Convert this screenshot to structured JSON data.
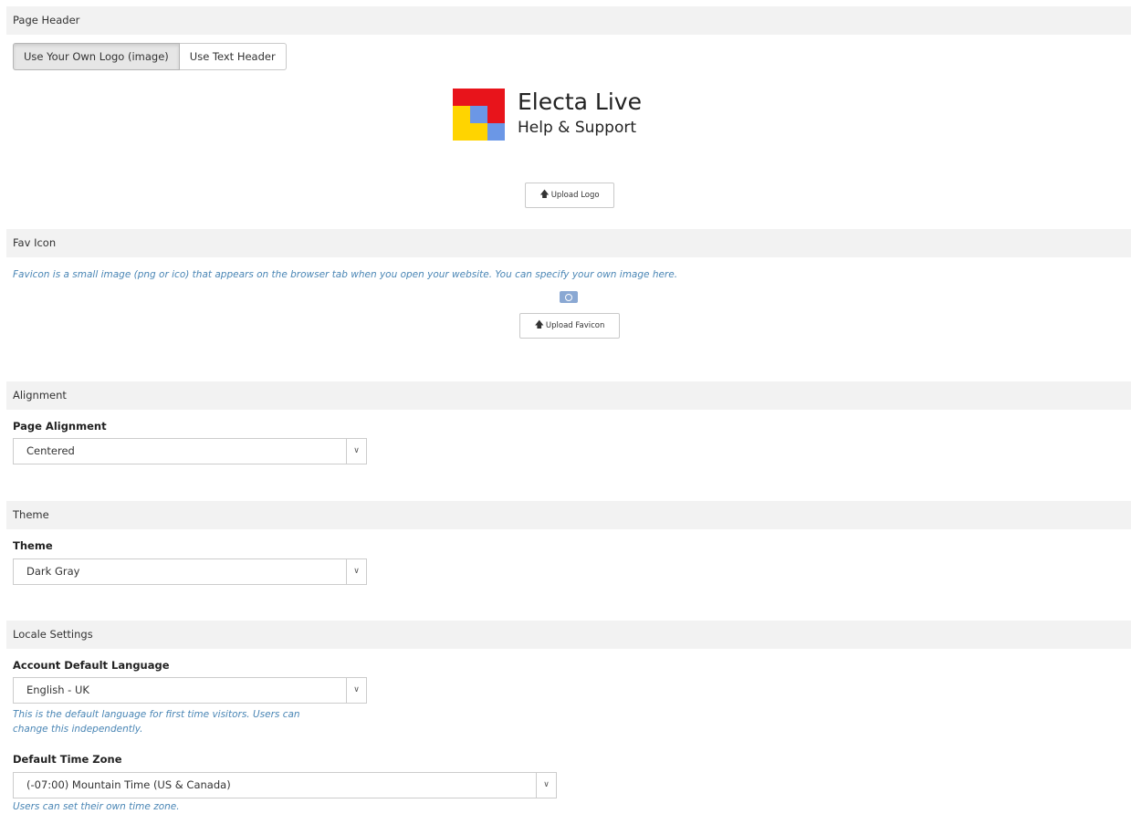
{
  "sections": {
    "page_header": "Page Header",
    "fav_icon": "Fav Icon",
    "alignment": "Alignment",
    "theme": "Theme",
    "locale": "Locale Settings"
  },
  "header_toggle": {
    "logo_option": "Use Your Own Logo (image)",
    "text_option": "Use Text Header",
    "selected": "logo_option"
  },
  "logo": {
    "line1": "Electa Live",
    "line2": "Help & Support",
    "colors": {
      "red": "#e8141b",
      "yellow": "#ffd400",
      "blue": "#6b97e6"
    }
  },
  "upload_logo_label": "Upload Logo",
  "favicon": {
    "help": "Favicon is a small image (png or ico) that appears on the browser tab when you open your website. You can specify your own image here.",
    "upload_label": "Upload Favicon"
  },
  "alignment": {
    "label": "Page Alignment",
    "value": "Centered"
  },
  "theme": {
    "label": "Theme",
    "value": "Dark Gray"
  },
  "locale": {
    "language_label": "Account Default Language",
    "language_value": "English - UK",
    "language_help_line1": "This is the default language for first time visitors. Users can",
    "language_help_line2": "change this independently.",
    "timezone_label": "Default Time Zone",
    "timezone_value": "(-07:00) Mountain Time (US & Canada)",
    "timezone_help": "Users can set their own time zone."
  },
  "colors": {
    "section_bg": "#f2f2f2",
    "help_text": "#4a86b5",
    "border": "#cccccc"
  }
}
